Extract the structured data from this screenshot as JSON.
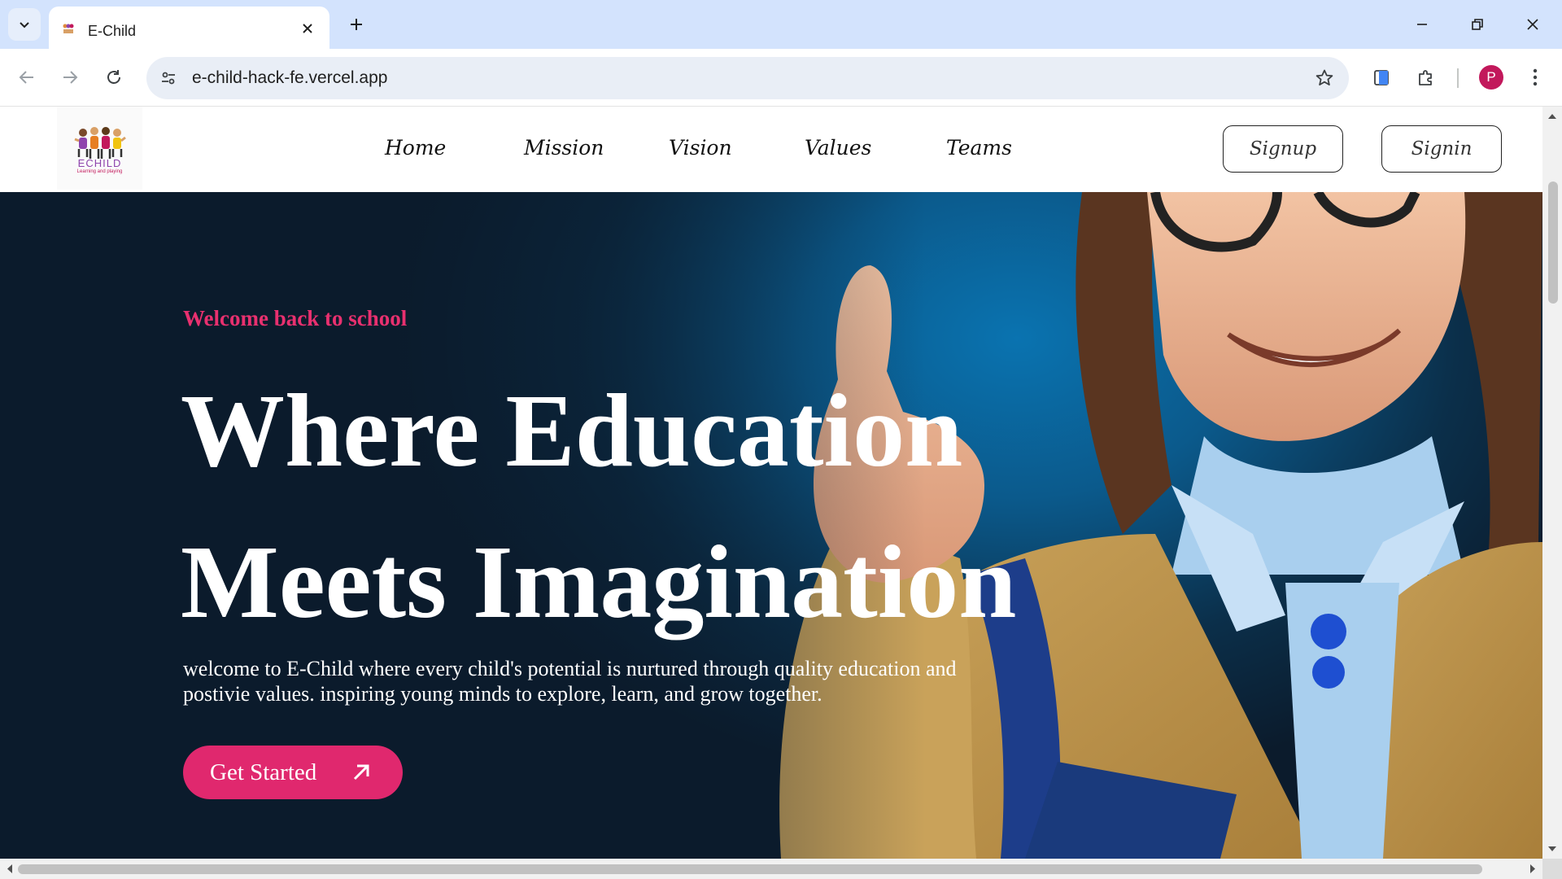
{
  "browser": {
    "tab_title": "E-Child",
    "url": "e-child-hack-fe.vercel.app",
    "profile_initial": "P",
    "accent": "#d3e3fd",
    "profile_color": "#c2185b"
  },
  "site": {
    "logo": {
      "name": "ECHILD",
      "tagline": "Learning and playing"
    },
    "nav": [
      "Home",
      "Mission",
      "Vision",
      "Values",
      "Teams"
    ],
    "signup_label": "Signup",
    "signin_label": "Signin"
  },
  "hero": {
    "eyebrow": "Welcome back to school",
    "headline_line1": "Where Education",
    "headline_line2": "Meets Imagination",
    "description": "welcome to E-Child where every child's potential is nurtured through quality education and postivie values. inspiring young minds to explore, learn, and grow together.",
    "cta_label": "Get Started",
    "cta_color": "#e0286e",
    "eyebrow_color": "#e8306f",
    "image": "smiling girl in school uniform giving thumbs up with backpack"
  },
  "icons": {
    "tab_search": "chevron-down-icon",
    "close": "close-icon",
    "new_tab": "plus-icon",
    "back": "arrow-left-icon",
    "forward": "arrow-right-icon",
    "reload": "reload-icon",
    "site_info": "tune-icon",
    "bookmark": "star-icon",
    "cta_arrow": "arrow-up-right-icon"
  }
}
